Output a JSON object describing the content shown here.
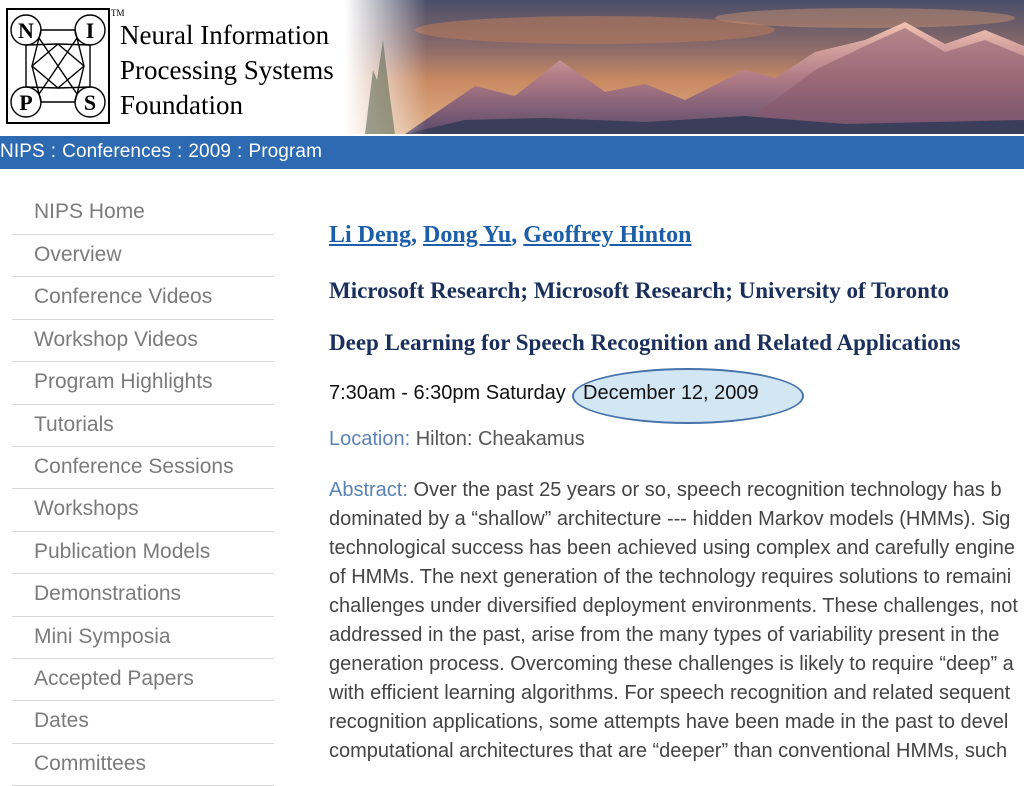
{
  "header": {
    "logo_letters": [
      "N",
      "I",
      "P",
      "S"
    ],
    "tm": "TM",
    "foundation_lines": [
      "Neural Information",
      "Processing Systems",
      "Foundation"
    ]
  },
  "breadcrumb": [
    "NIPS",
    "Conferences",
    "2009",
    "Program"
  ],
  "sidebar": {
    "items": [
      {
        "label": "NIPS Home"
      },
      {
        "label": "Overview"
      },
      {
        "label": "Conference Videos"
      },
      {
        "label": "Workshop Videos"
      },
      {
        "label": "Program Highlights"
      },
      {
        "label": "Tutorials"
      },
      {
        "label": "Conference Sessions"
      },
      {
        "label": "Workshops"
      },
      {
        "label": "Publication Models"
      },
      {
        "label": "Demonstrations"
      },
      {
        "label": "Mini Symposia"
      },
      {
        "label": "Accepted Papers"
      },
      {
        "label": "Dates"
      },
      {
        "label": "Committees"
      }
    ]
  },
  "main": {
    "authors": [
      "Li Deng",
      "Dong Yu",
      "Geoffrey Hinton"
    ],
    "affiliation": "Microsoft Research; Microsoft Research; University of Toronto",
    "title": "Deep Learning for Speech Recognition and Related Applications",
    "time": "7:30am - 6:30pm Saturday",
    "date": "December 12, 2009",
    "location_label": "Location:",
    "location": "Hilton: Cheakamus",
    "abstract_label": "Abstract:",
    "abstract_lines": [
      " Over the past 25 years or so, speech recognition technology has b",
      "dominated by a “shallow” architecture --- hidden Markov models (HMMs). Sig",
      "technological success has been achieved using complex and carefully engine",
      "of HMMs. The next generation of the technology requires solutions to remaini",
      "challenges under diversified deployment environments. These challenges, not",
      "addressed in the past, arise from the many types of variability present in the",
      "generation process. Overcoming these challenges is likely to require “deep” a",
      "with efficient learning algorithms. For speech recognition and related sequent",
      "recognition applications, some attempts have been made in the past to devel",
      "computational architectures that are “deeper” than conventional HMMs, such"
    ]
  },
  "colors": {
    "crumb_bar": "#2e6ab1",
    "link": "#1d5ea8",
    "heading": "#1a2f5c",
    "label": "#5b82b8",
    "highlight_fill": "#d3e6f4",
    "highlight_stroke": "#4573ab"
  }
}
